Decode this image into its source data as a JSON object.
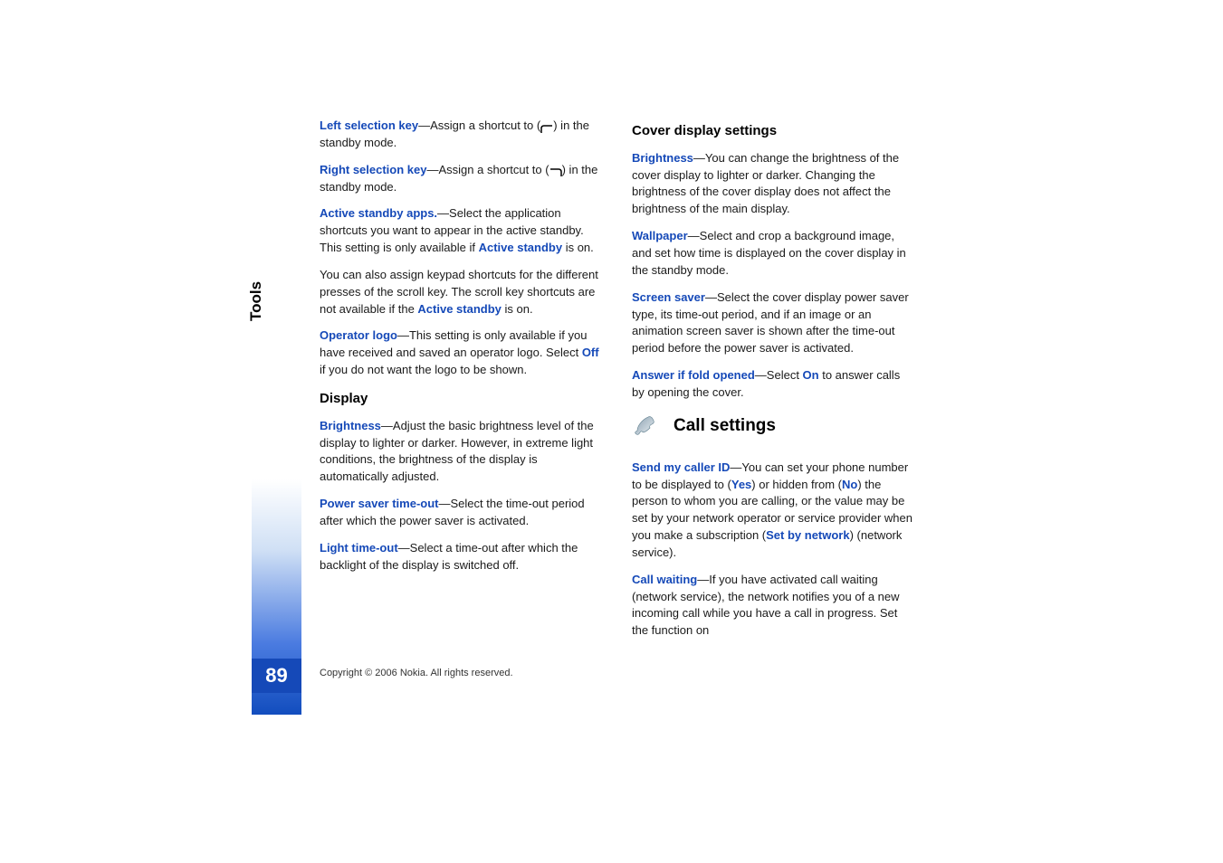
{
  "sideTab": "Tools",
  "pageNumber": "89",
  "copyright": "Copyright © 2006 Nokia. All rights reserved.",
  "col1": {
    "p1": {
      "label": "Left selection key",
      "text1": "—Assign a shortcut to (",
      "text2": ") in the standby mode."
    },
    "p2": {
      "label": "Right selection key",
      "text1": "—Assign a shortcut to (",
      "text2": ") in the standby mode."
    },
    "p3": {
      "label": "Active standby apps.",
      "text1": "—Select the application shortcuts you want to appear in the active standby. This setting is only available if ",
      "ref": "Active standby",
      "text2": " is on."
    },
    "p4": {
      "text1": "You can also assign keypad shortcuts for the different presses of the scroll key. The scroll key shortcuts are not available if the ",
      "ref": "Active standby",
      "text2": " is on."
    },
    "p5": {
      "label": "Operator logo",
      "text1": "—This setting is only available if you have received and saved an operator logo. Select ",
      "ref": "Off",
      "text2": " if you do not want the logo to be shown."
    },
    "displayHeading": "Display",
    "p6": {
      "label": "Brightness",
      "text": "—Adjust the basic brightness level of the display to lighter or darker. However, in extreme light conditions, the brightness of the display is automatically adjusted."
    },
    "p7": {
      "label": "Power saver time-out",
      "text": "—Select the time-out period after which the power saver is activated."
    },
    "p8": {
      "label": "Light time-out",
      "text": "—Select a time-out after which the backlight of the display is switched off."
    }
  },
  "col2": {
    "coverHeading": "Cover display settings",
    "p1": {
      "label": "Brightness",
      "text": "—You can change the brightness of the cover display to lighter or darker. Changing the brightness of the cover display does not affect the brightness of the main display."
    },
    "p2": {
      "label": "Wallpaper",
      "text": "—Select and crop a background image, and set how time is displayed on the cover display in the standby mode."
    },
    "p3": {
      "label": "Screen saver",
      "text": "—Select the cover display power saver type, its time-out period, and if an image or an animation screen saver is shown after the time-out period before the power saver is activated."
    },
    "p4": {
      "label": "Answer if fold opened",
      "text1": "—Select ",
      "ref": "On",
      "text2": " to answer calls by opening the cover."
    },
    "callHeading": "Call settings",
    "p5": {
      "label": "Send my caller ID",
      "t1": "—You can set your phone number to be displayed to (",
      "yes": "Yes",
      "t2": ") or hidden from (",
      "no": "No",
      "t3": ") the person to whom you are calling, or the value may be set by your network operator or service provider when you make a subscription (",
      "sbn": "Set by network",
      "t4": ") (network service)."
    },
    "p6": {
      "label": "Call waiting",
      "text": "—If you have activated call waiting (network service), the network notifies you of a new incoming call while you have a call in progress. Set the function on"
    }
  }
}
